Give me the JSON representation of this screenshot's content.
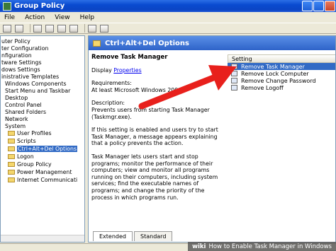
{
  "window": {
    "title": "Group Policy"
  },
  "menu": [
    "File",
    "Action",
    "View",
    "Help"
  ],
  "tree": [
    {
      "label": "uter Policy",
      "indent": 0
    },
    {
      "label": "ter Configuration",
      "indent": 0
    },
    {
      "label": "nfiguration",
      "indent": 0
    },
    {
      "label": "tware Settings",
      "indent": 0
    },
    {
      "label": "dows Settings",
      "indent": 0
    },
    {
      "label": "inistrative Templates",
      "indent": 0
    },
    {
      "label": "Windows Components",
      "indent": 1
    },
    {
      "label": "Start Menu and Taskbar",
      "indent": 1
    },
    {
      "label": "Desktop",
      "indent": 1
    },
    {
      "label": "Control Panel",
      "indent": 1
    },
    {
      "label": "Shared Folders",
      "indent": 1
    },
    {
      "label": "Network",
      "indent": 1
    },
    {
      "label": "System",
      "indent": 1
    },
    {
      "label": "User Profiles",
      "indent": 2,
      "folder": true
    },
    {
      "label": "Scripts",
      "indent": 2,
      "folder": true
    },
    {
      "label": "Ctrl+Alt+Del Options",
      "indent": 2,
      "folder": true,
      "selected": true
    },
    {
      "label": "Logon",
      "indent": 2,
      "folder": true
    },
    {
      "label": "Group Policy",
      "indent": 2,
      "folder": true
    },
    {
      "label": "Power Management",
      "indent": 2,
      "folder": true
    },
    {
      "label": "Internet Communicati",
      "indent": 2,
      "folder": true
    }
  ],
  "section": {
    "title": "Ctrl+Alt+Del Options"
  },
  "extended": {
    "title": "Remove Task Manager",
    "display_label": "Display",
    "properties_link": "Properties",
    "requirements_label": "Requirements:",
    "requirements_value": "At least Microsoft Windows 2000",
    "description_label": "Description:",
    "description_value": "Prevents users from starting Task Manager (Taskmgr.exe).",
    "para2": "If this setting is enabled and users try to start Task Manager, a message appears explaining that a policy prevents the action.",
    "para3": "Task Manager lets users start and stop programs; monitor the performance of their computers; view and monitor all programs running on their computers, including system services; find the executable names of programs; and change the priority of the process in which programs run."
  },
  "list": {
    "column": "Setting",
    "items": [
      {
        "label": "Remove Task Manager",
        "selected": true
      },
      {
        "label": "Remove Lock Computer",
        "selected": false
      },
      {
        "label": "Remove Change Password",
        "selected": false
      },
      {
        "label": "Remove Logoff",
        "selected": false
      }
    ]
  },
  "tabs": {
    "extended": "Extended",
    "standard": "Standard"
  },
  "caption": {
    "brand": "wiki",
    "text": "How to Enable Task Manager in Windows"
  },
  "colors": {
    "arrow": "#e8201c",
    "selection": "#316ac5",
    "title_bar": "#0a4bd0"
  }
}
